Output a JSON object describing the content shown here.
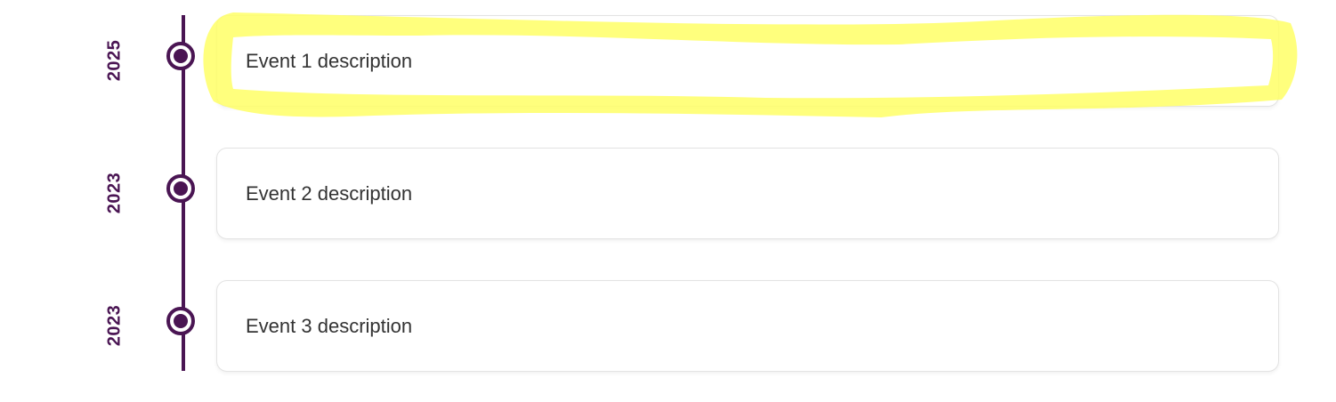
{
  "colors": {
    "accent": "#4a1553",
    "card_border": "#e3e3e3",
    "text": "#333333",
    "highlight": "#ffff66"
  },
  "timeline": {
    "events": [
      {
        "year": "2025",
        "description": "Event 1 description",
        "highlighted": true
      },
      {
        "year": "2023",
        "description": "Event 2 description",
        "highlighted": false
      },
      {
        "year": "2023",
        "description": "Event 3 description",
        "highlighted": false
      }
    ]
  }
}
